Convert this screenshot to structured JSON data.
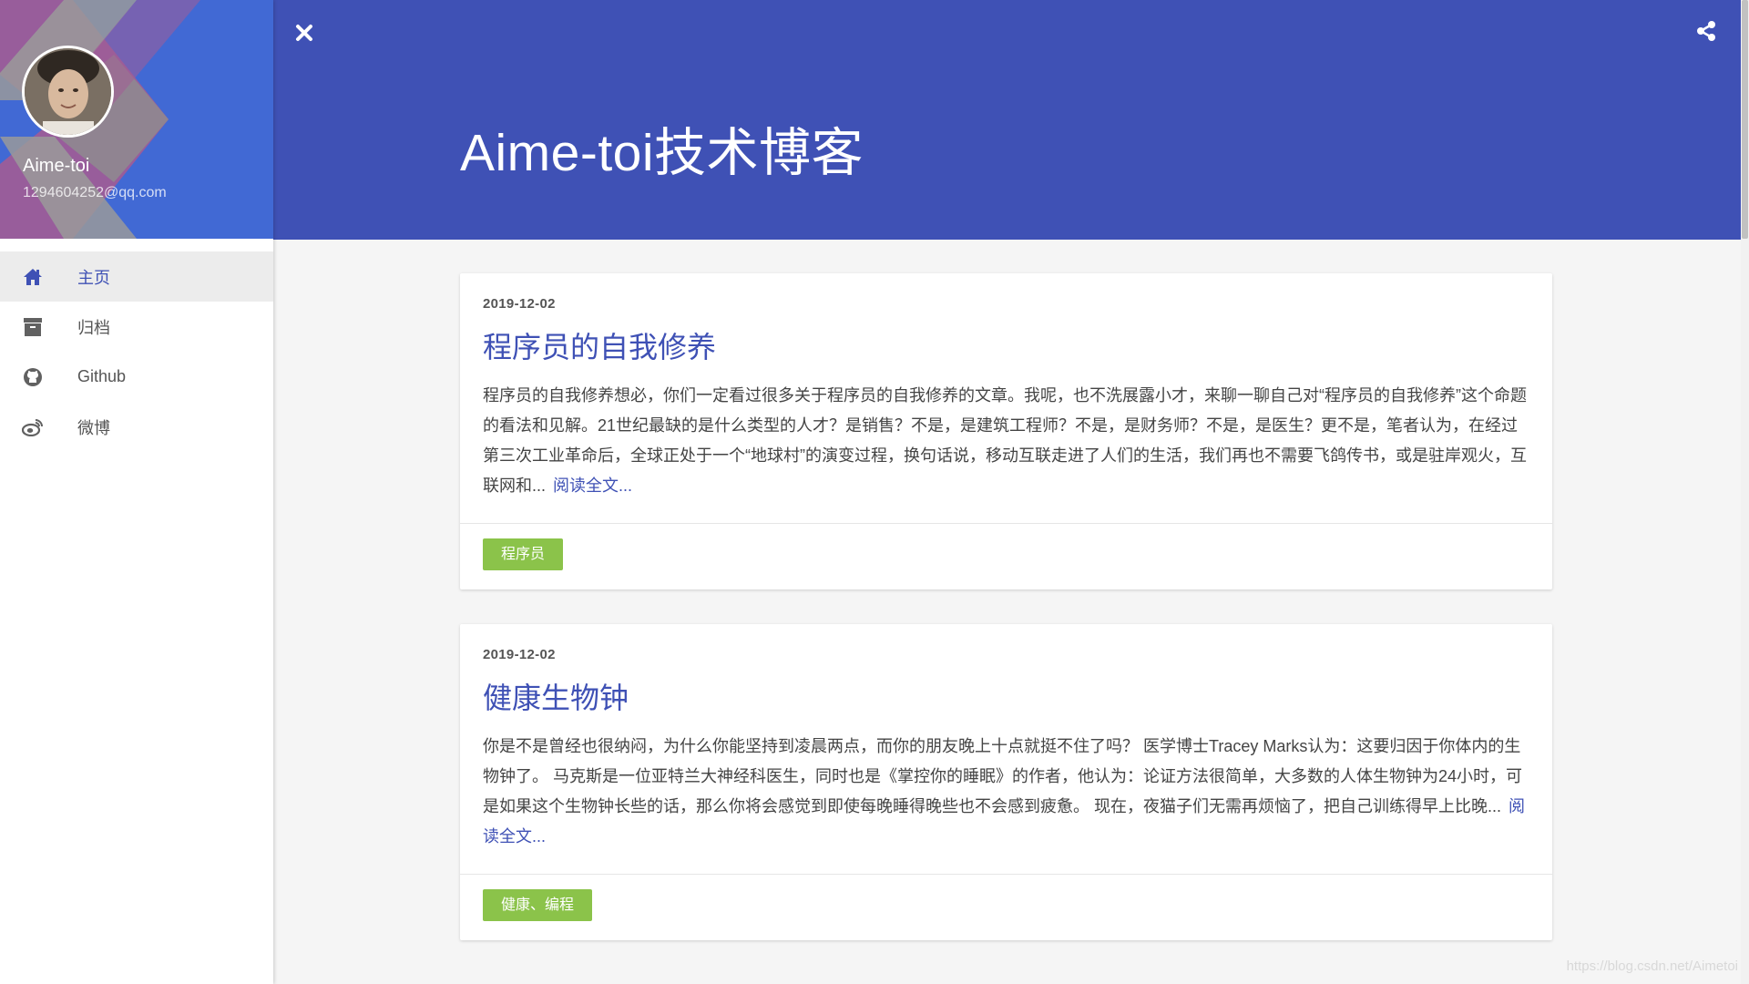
{
  "sidebar": {
    "profile": {
      "name": "Aime-toi",
      "email": "1294604252@qq.com"
    },
    "items": [
      {
        "label": "主页",
        "icon": "home-icon",
        "active": true
      },
      {
        "label": "归档",
        "icon": "archive-icon",
        "active": false
      },
      {
        "label": "Github",
        "icon": "github-icon",
        "active": false
      },
      {
        "label": "微博",
        "icon": "weibo-icon",
        "active": false
      }
    ]
  },
  "header": {
    "title": "Aime-toi技术博客",
    "close_icon": "close-icon",
    "share_icon": "share-icon"
  },
  "posts": [
    {
      "date": "2019-12-02",
      "title": "程序员的自我修养",
      "excerpt": "程序员的自我修养想必，你们一定看过很多关于程序员的自我修养的文章。我呢，也不洗展露小才，来聊一聊自己对“程序员的自我修养”这个命题的看法和见解。21世纪最缺的是什么类型的人才？是销售？不是，是建筑工程师？不是，是财务师？不是，是医生？更不是，笔者认为，在经过第三次工业革命后，全球正处于一个“地球村”的演变过程，换句话说，移动互联走进了人们的生活，我们再也不需要飞鸽传书，或是驻岸观火，互联网和...",
      "read_more": "阅读全文...",
      "tag": "程序员"
    },
    {
      "date": "2019-12-02",
      "title": "健康生物钟",
      "excerpt": "你是不是曾经也很纳闷，为什么你能坚持到凌晨两点，而你的朋友晚上十点就挺不住了吗？ 医学博士Tracey Marks认为：这要归因于你体内的生物钟了。 马克斯是一位亚特兰大神经科医生，同时也是《掌控你的睡眠》的作者，他认为：论证方法很简单，大多数的人体生物钟为24小时，可是如果这个生物钟长些的话，那么你将会感觉到即使每晚睡得晚些也不会感到疲惫。 现在，夜猫子们无需再烦恼了，把自己训练得早上比晚...",
      "read_more": "阅读全文...",
      "tag": "健康、编程"
    }
  ],
  "watermark": "https://blog.csdn.net/Aimetoi",
  "colors": {
    "primary": "#3f51b5",
    "sidebar_header": "#4169d4",
    "tag": "#8bc34a"
  }
}
